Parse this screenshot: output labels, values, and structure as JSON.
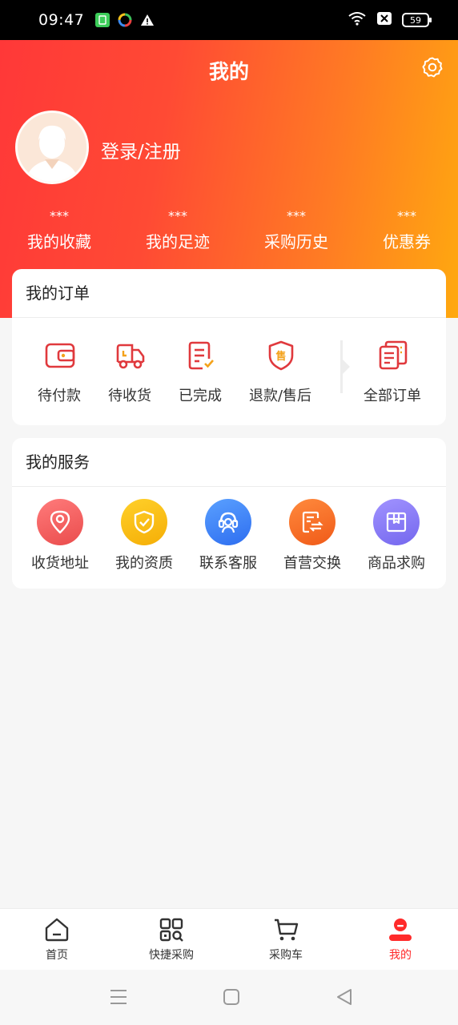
{
  "status_bar": {
    "time": "09:47",
    "battery": "59",
    "icons": [
      "app-green-icon",
      "colorful-app-icon",
      "warning-icon",
      "wifi-icon",
      "x-box-icon",
      "battery-icon"
    ]
  },
  "header": {
    "title": "我的",
    "login_text": "登录/注册",
    "gradient_colors": [
      "#ff3838",
      "#ffa90f"
    ]
  },
  "stats": [
    {
      "value": "***",
      "label": "我的收藏"
    },
    {
      "value": "***",
      "label": "我的足迹"
    },
    {
      "value": "***",
      "label": "采购历史"
    },
    {
      "value": "***",
      "label": "优惠券"
    }
  ],
  "orders": {
    "title": "我的订单",
    "items": [
      {
        "label": "待付款",
        "icon": "wallet-icon"
      },
      {
        "label": "待收货",
        "icon": "truck-icon"
      },
      {
        "label": "已完成",
        "icon": "completed-doc-icon"
      },
      {
        "label": "退款/售后",
        "icon": "after-sale-shield-icon"
      },
      {
        "label": "全部订单",
        "icon": "all-orders-icon"
      }
    ],
    "after_sale_glyph": "售"
  },
  "services": {
    "title": "我的服务",
    "items": [
      {
        "label": "收货地址",
        "icon": "location-pin-icon",
        "color": "#f25a5a"
      },
      {
        "label": "我的资质",
        "icon": "shield-check-icon",
        "color": "#f9b90f"
      },
      {
        "label": "联系客服",
        "icon": "headset-icon",
        "color": "#3f82f5"
      },
      {
        "label": "首营交换",
        "icon": "exchange-doc-icon",
        "color": "#f76a2a"
      },
      {
        "label": "商品求购",
        "icon": "package-icon",
        "color": "#8a7cf5"
      }
    ]
  },
  "bottom_nav": [
    {
      "label": "首页",
      "icon": "home-icon",
      "active": false
    },
    {
      "label": "快捷采购",
      "icon": "quick-purchase-icon",
      "active": false
    },
    {
      "label": "采购车",
      "icon": "cart-icon",
      "active": false
    },
    {
      "label": "我的",
      "icon": "profile-icon",
      "active": true
    }
  ],
  "colors": {
    "accent": "#ff2a2a",
    "icon_red": "#e0393d"
  }
}
